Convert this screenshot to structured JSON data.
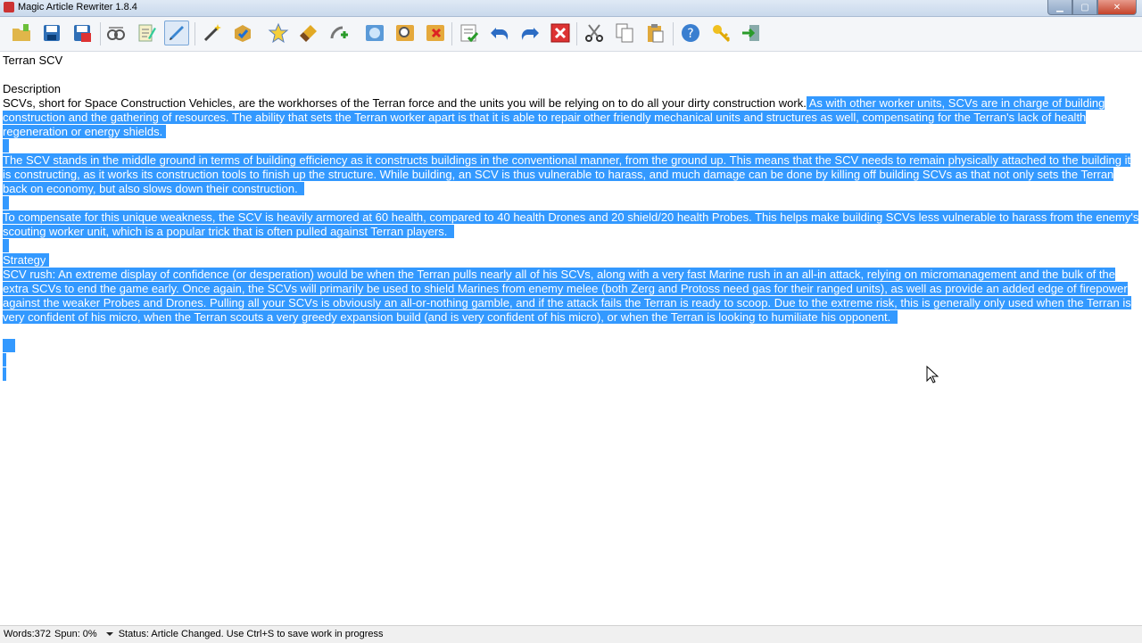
{
  "window": {
    "title": "Magic Article Rewriter 1.8.4"
  },
  "toolbar": {
    "buttons": [
      "open-icon",
      "save-icon",
      "save-as-icon",
      "spin-icon",
      "notes-icon",
      "pencil-icon",
      "magic-wand-icon",
      "approve-icon",
      "star-icon",
      "brush-icon",
      "add-synonym-icon",
      "globe-icon",
      "search-icon",
      "delete-box-icon",
      "checklist-icon",
      "undo-icon",
      "redo-icon",
      "close-red-icon",
      "cut-icon",
      "copy-icon",
      "paste-icon",
      "help-icon",
      "key-icon",
      "exit-icon"
    ],
    "colors": {
      "active": "#dde9f7"
    }
  },
  "document": {
    "title": "Terran SCV",
    "description_heading": "Description",
    "p1_plain": "SCVs, short for Space Construction Vehicles, are the workhorses of the Terran force and the units you will be relying on to do all your dirty construction work.",
    "p1_selected": " As with other worker units, SCVs are in charge of building construction and the gathering of resources. The ability that sets the Terran worker apart is that it is able to repair other friendly mechanical units and structures as well, compensating for the Terran's lack of health regeneration or energy shields.",
    "p2": "The SCV stands in the middle ground in terms of building efficiency as it constructs buildings in the conventional manner, from the ground up. This means that the SCV needs to remain physically attached to the building it is constructing, as it works its construction tools to finish up the structure. While building, an SCV is thus vulnerable to harass, and much damage can be done by killing off building SCVs as that not only sets the Terran back on economy, but also slows down their construction.",
    "p3": "To compensate for this unique weakness, the SCV is heavily armored at 60 health, compared to 40 health Drones and 20 shield/20 health Probes. This helps make building SCVs less vulnerable to harass from the enemy's scouting worker unit, which is a popular trick that is often pulled against Terran players.",
    "strategy_heading": "Strategy",
    "p4": "SCV rush: An extreme display of confidence (or desperation) would be when the Terran pulls nearly all of his SCVs, along with a very fast Marine rush in an all-in attack, relying on micromanagement and the bulk of the extra SCVs to end the game early. Once again, the SCVs will primarily be used to shield Marines from enemy melee (both Zerg and Protoss need gas for their ranged units), as well as provide an added edge of firepower against the weaker Probes and Drones. Pulling all your SCVs is obviously an all-or-nothing gamble, and if the attack fails the Terran is ready to scoop. Due to the extreme risk, this is generally only used when the Terran is very confident of his micro, when the Terran scouts a very greedy expansion build (and is very confident of his micro), or when the Terran is looking to humiliate his opponent.",
    "selection_color": "#3399ff"
  },
  "status": {
    "words": "Words:372",
    "spun": "Spun: 0%",
    "message": "Status: Article Changed. Use Ctrl+S to save work in progress"
  }
}
